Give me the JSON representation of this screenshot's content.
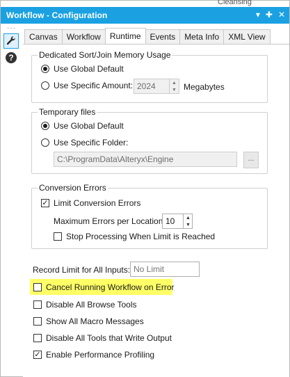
{
  "window": {
    "title": "Workflow - Configuration",
    "top_peek": "Cleansing",
    "pin_glyph": "▾ ✚ ✕"
  },
  "sidebar": {
    "dots": "···",
    "help_glyph": "?"
  },
  "tabs": [
    "Canvas",
    "Workflow",
    "Runtime",
    "Events",
    "Meta Info",
    "XML View"
  ],
  "active_tab": "Runtime",
  "sort_join": {
    "legend": "Dedicated Sort/Join Memory Usage",
    "opt_global": "Use Global Default",
    "opt_specific": "Use Specific Amount:",
    "amount_value": "2024",
    "unit": "Megabytes",
    "selected": "global"
  },
  "temp_files": {
    "legend": "Temporary files",
    "opt_global": "Use Global Default",
    "opt_specific": "Use Specific Folder:",
    "folder_value": "C:\\ProgramData\\Alteryx\\Engine",
    "browse_label": "...",
    "selected": "global"
  },
  "conversion": {
    "legend": "Conversion Errors",
    "limit_label": "Limit Conversion Errors",
    "limit_checked": true,
    "max_label": "Maximum Errors per Location:",
    "max_value": "10",
    "stop_label": "Stop Processing When Limit is Reached",
    "stop_checked": false
  },
  "record_limit": {
    "label": "Record Limit for All Inputs:",
    "placeholder": "No Limit"
  },
  "options": [
    {
      "label": "Cancel Running Workflow on Error",
      "checked": false,
      "highlight": true
    },
    {
      "label": "Disable All Browse Tools",
      "checked": false
    },
    {
      "label": "Show All Macro Messages",
      "checked": false
    },
    {
      "label": "Disable All Tools that Write Output",
      "checked": false
    },
    {
      "label": "Enable Performance Profiling",
      "checked": true
    }
  ],
  "colors": {
    "titlebar": "#1ba1e2",
    "highlight": "#ffff66"
  }
}
